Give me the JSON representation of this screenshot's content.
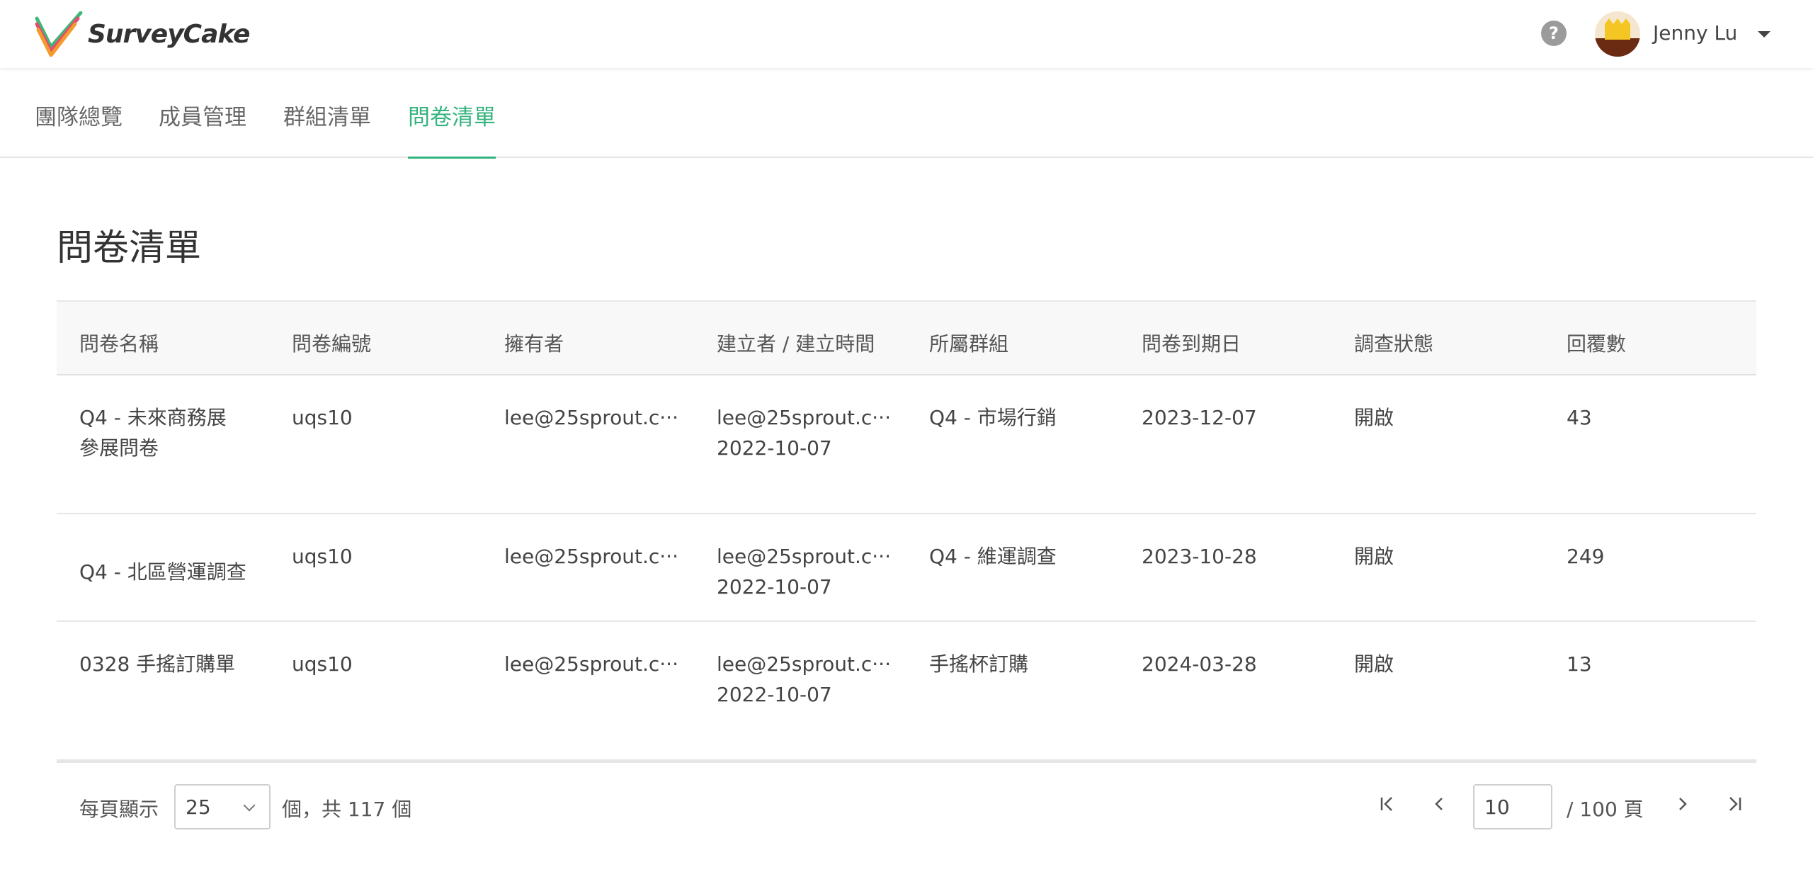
{
  "header": {
    "logo_text": "SurveyCake",
    "help_icon": "question-circle-icon",
    "user_name": "Jenny Lu"
  },
  "tabs": [
    {
      "label": "團隊總覽"
    },
    {
      "label": "成員管理"
    },
    {
      "label": "群組清單"
    },
    {
      "label": "問卷清單",
      "active": true
    }
  ],
  "page_title": "問卷清單",
  "table": {
    "columns": [
      "問卷名稱",
      "問卷編號",
      "擁有者",
      "建立者 / 建立時間",
      "所屬群組",
      "問卷到期日",
      "調查狀態",
      "回覆數"
    ],
    "rows": [
      {
        "name_line1": "Q4 - 未來商務展",
        "name_line2": "參展問卷",
        "code": "uqs10",
        "owner": "lee@25sprout.c···",
        "creator": "lee@25sprout.c···",
        "created": "2022-10-07",
        "group": "Q4 - 市場行銷",
        "due": "2023-12-07",
        "status": "開啟",
        "replies": "43"
      },
      {
        "name_line1": "Q4 - 北區營運調查",
        "name_line2": "",
        "code": "uqs10",
        "owner": "lee@25sprout.c···",
        "creator": "lee@25sprout.c···",
        "created": "2022-10-07",
        "group": "Q4 - 維運調查",
        "due": "2023-10-28",
        "status": "開啟",
        "replies": "249"
      },
      {
        "name_line1": "0328 手搖訂購單",
        "name_line2": "",
        "code": "uqs10",
        "owner": "lee@25sprout.c···",
        "creator": "lee@25sprout.c···",
        "created": "2022-10-07",
        "group": "手搖杯訂購",
        "due": "2024-03-28",
        "status": "開啟",
        "replies": "13"
      }
    ]
  },
  "pagination": {
    "per_page_label": "每頁顯示",
    "per_page_value": "25",
    "total_text": "個，共 117 個",
    "current_page": "10",
    "total_pages_text": "/  100 頁"
  },
  "colors": {
    "accent": "#35b37e"
  }
}
